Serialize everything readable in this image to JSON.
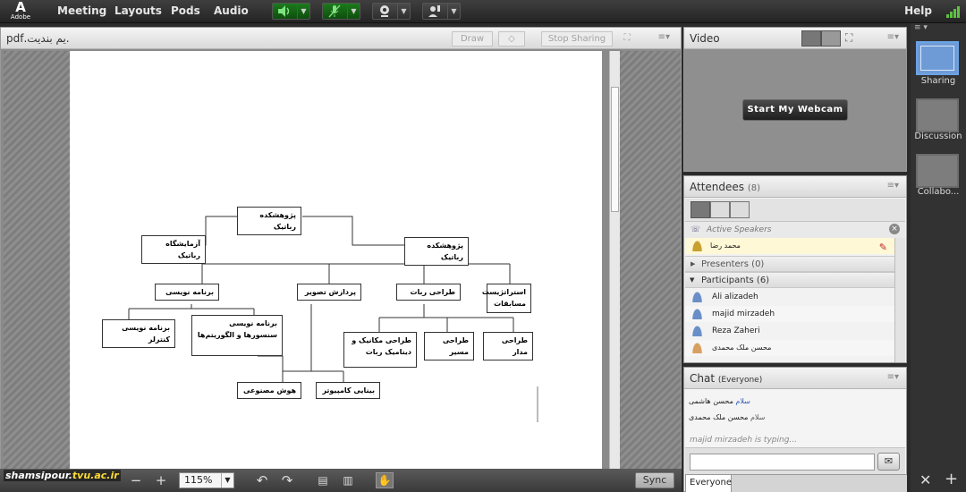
{
  "app": {
    "logo_text": "Adobe",
    "brand_color": "#2b2b2b",
    "accent_color": "#5a8fd6"
  },
  "menu": [
    "Meeting",
    "Layouts",
    "Pods",
    "Audio"
  ],
  "help": "Help",
  "share_pod": {
    "title": ".يم بندیت.pdf",
    "draw": "Draw",
    "stop_sharing": "Stop Sharing",
    "zoom": "115%",
    "sync": "Sync"
  },
  "diagram": {
    "root": "پژوهشکده رباتیک",
    "left": "آزمایشگاه رباتیک",
    "center": "پژوهشکده رباتیک",
    "b1": "برنامه نویسی",
    "b2": "پردازش تصویر",
    "b3": "طراحی ربات",
    "b4": "استراتژیست مسابقات",
    "c1": "برنامه نویسی کنترلر",
    "c2": "برنامه نویسی سنسورها و الگوریتم‌ها",
    "c3": "طراحی مکانیک و دینامیک ربات",
    "c4": "طراحی مسیر",
    "c5": "طراحی مدار",
    "d1": "هوش مصنوعی",
    "d2": "بینایی کامپیوتر"
  },
  "video": {
    "title": "Video",
    "start_webcam": "Start My Webcam"
  },
  "attendees": {
    "title": "Attendees",
    "count": "(8)",
    "active_speakers": "Active Speakers",
    "speaker_name": "محمد رضا",
    "presenters": "Presenters (0)",
    "participants": "Participants (6)",
    "people": [
      "Ali alizadeh",
      "majid mirzadeh",
      "Reza Zaheri",
      "محسن ملک محمدی"
    ]
  },
  "chat": {
    "title": "Chat",
    "scope": "(Everyone)",
    "messages": [
      {
        "name": "محسن هاشمی",
        "text": "سلام"
      },
      {
        "name": "محسن ملک محمدی",
        "text": "سلام"
      }
    ],
    "typing": "majid mirzadeh is typing...",
    "recipient": "Everyone"
  },
  "layouts": [
    "Sharing",
    "Discussion",
    "Collabo..."
  ],
  "watermark": {
    "part1": "shamsipour.",
    "part2": "tvu.ac.ir"
  }
}
